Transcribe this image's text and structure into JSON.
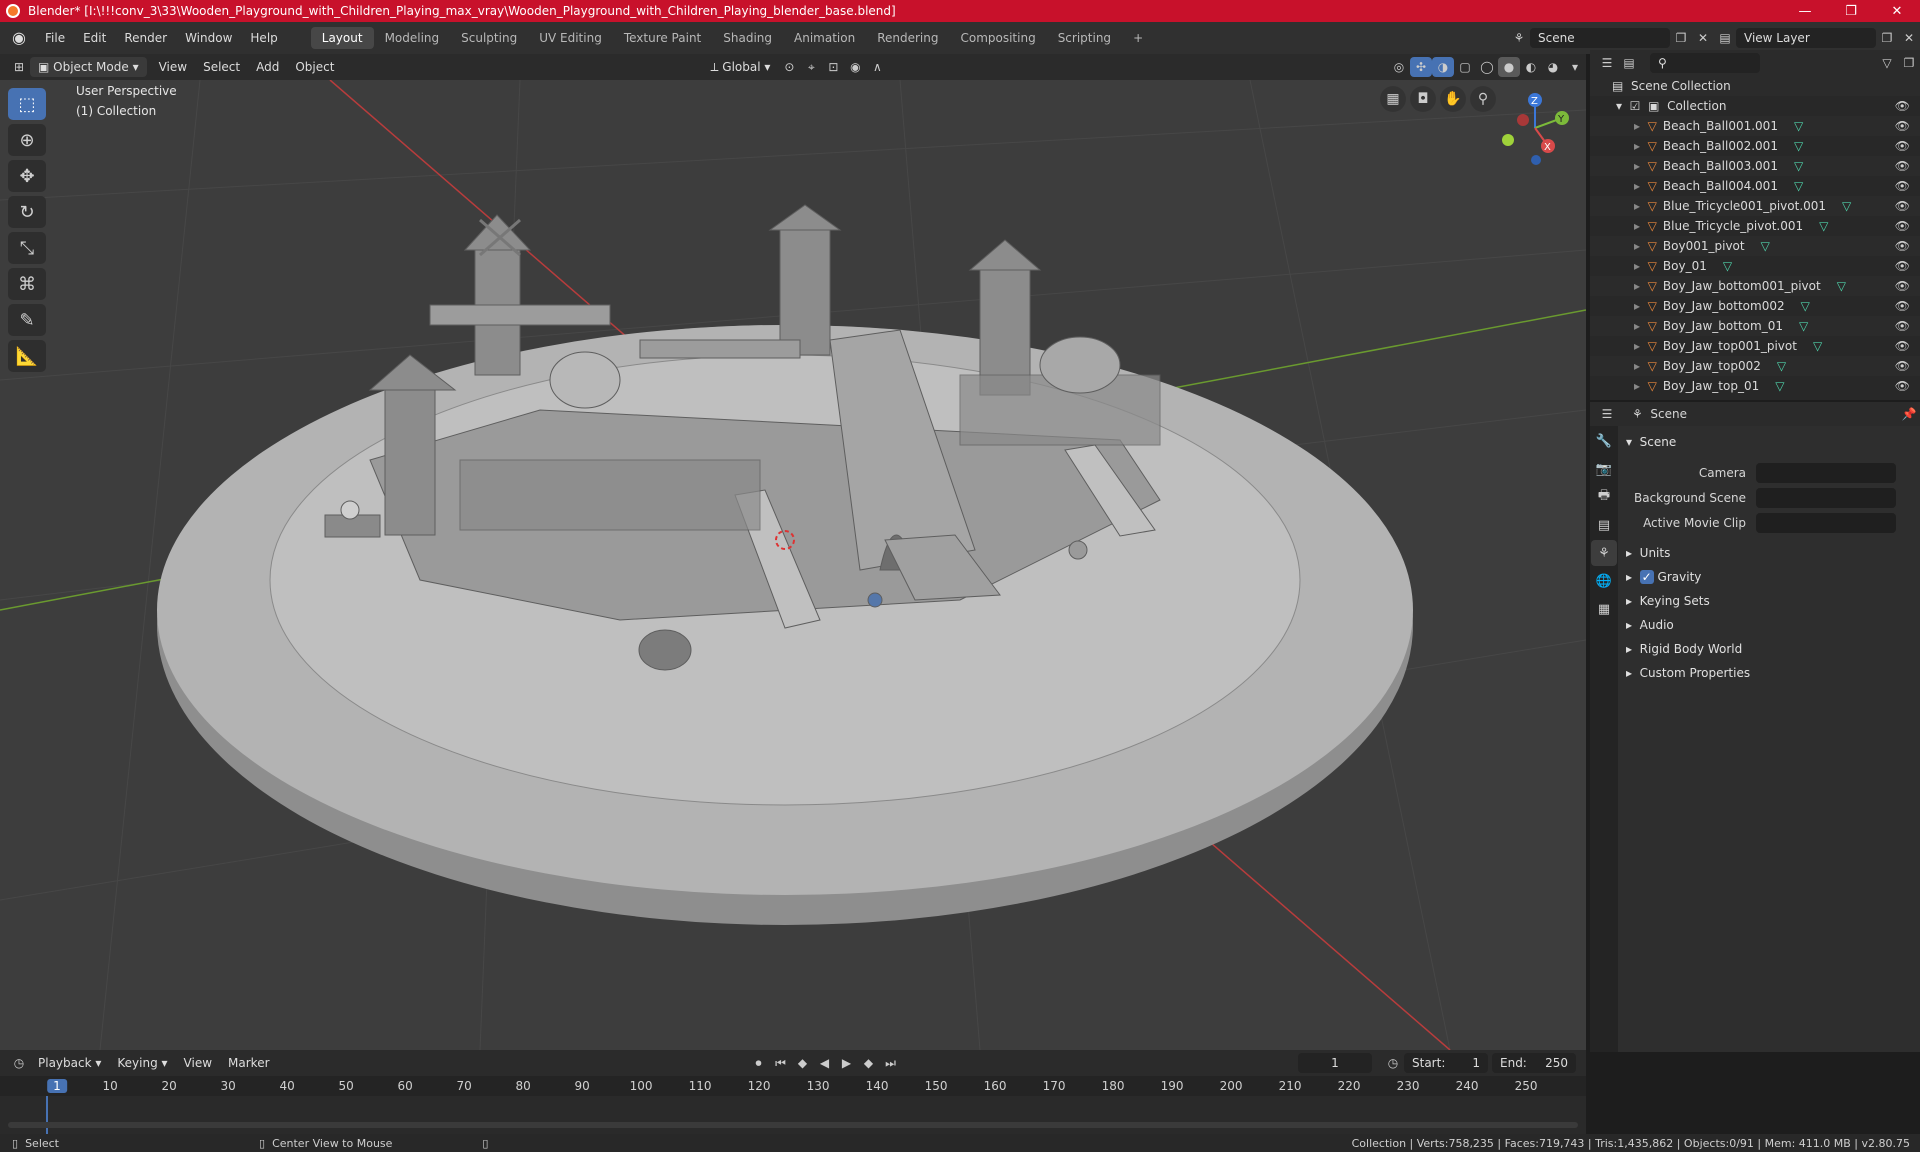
{
  "window": {
    "title": "Blender* [I:\\!!!conv_3\\33\\Wooden_Playground_with_Children_Playing_max_vray\\Wooden_Playground_with_Children_Playing_blender_base.blend]",
    "minimize": "—",
    "maximize": "❐",
    "close": "✕"
  },
  "menu": [
    "File",
    "Edit",
    "Render",
    "Window",
    "Help"
  ],
  "workspaces": [
    "Layout",
    "Modeling",
    "Sculpting",
    "UV Editing",
    "Texture Paint",
    "Shading",
    "Animation",
    "Rendering",
    "Compositing",
    "Scripting"
  ],
  "add_workspace": "+",
  "scene_field": "Scene",
  "view_layer_field": "View Layer",
  "viewport_header": {
    "mode": "Object Mode",
    "menus": [
      "View",
      "Select",
      "Add",
      "Object"
    ],
    "orientation": "Global"
  },
  "viewport": {
    "perspective": "User Perspective",
    "collection": "(1) Collection",
    "gizmo": {
      "z": "Z",
      "y": "Y",
      "x": "X"
    }
  },
  "outliner": {
    "root": "Scene Collection",
    "collection": "Collection",
    "items": [
      "Beach_Ball001.001",
      "Beach_Ball002.001",
      "Beach_Ball003.001",
      "Beach_Ball004.001",
      "Blue_Tricycle001_pivot.001",
      "Blue_Tricycle_pivot.001",
      "Boy001_pivot",
      "Boy_01",
      "Boy_Jaw_bottom001_pivot",
      "Boy_Jaw_bottom002",
      "Boy_Jaw_bottom_01",
      "Boy_Jaw_top001_pivot",
      "Boy_Jaw_top002",
      "Boy_Jaw_top_01"
    ]
  },
  "properties": {
    "context": "Scene",
    "section": "Scene",
    "fields": [
      {
        "label": "Camera"
      },
      {
        "label": "Background Scene"
      },
      {
        "label": "Active Movie Clip"
      }
    ],
    "panels": [
      "Units",
      "Gravity",
      "Keying Sets",
      "Audio",
      "Rigid Body World",
      "Custom Properties"
    ]
  },
  "timeline": {
    "menus": [
      "Playback",
      "Keying",
      "View",
      "Marker"
    ],
    "current_frame": "1",
    "start_label": "Start:",
    "start": "1",
    "end_label": "End:",
    "end": "250",
    "frame_labels": [
      "1",
      "10",
      "20",
      "30",
      "40",
      "50",
      "60",
      "70",
      "80",
      "90",
      "100",
      "110",
      "120",
      "130",
      "140",
      "150",
      "160",
      "170",
      "180",
      "190",
      "200",
      "210",
      "220",
      "230",
      "240",
      "250"
    ]
  },
  "status": {
    "left": "Select",
    "middle": "Center View to Mouse",
    "right": "Collection | Verts:758,235 | Faces:719,743 | Tris:1,435,862 | Objects:0/91 | Mem: 411.0 MB | v2.80.75"
  }
}
